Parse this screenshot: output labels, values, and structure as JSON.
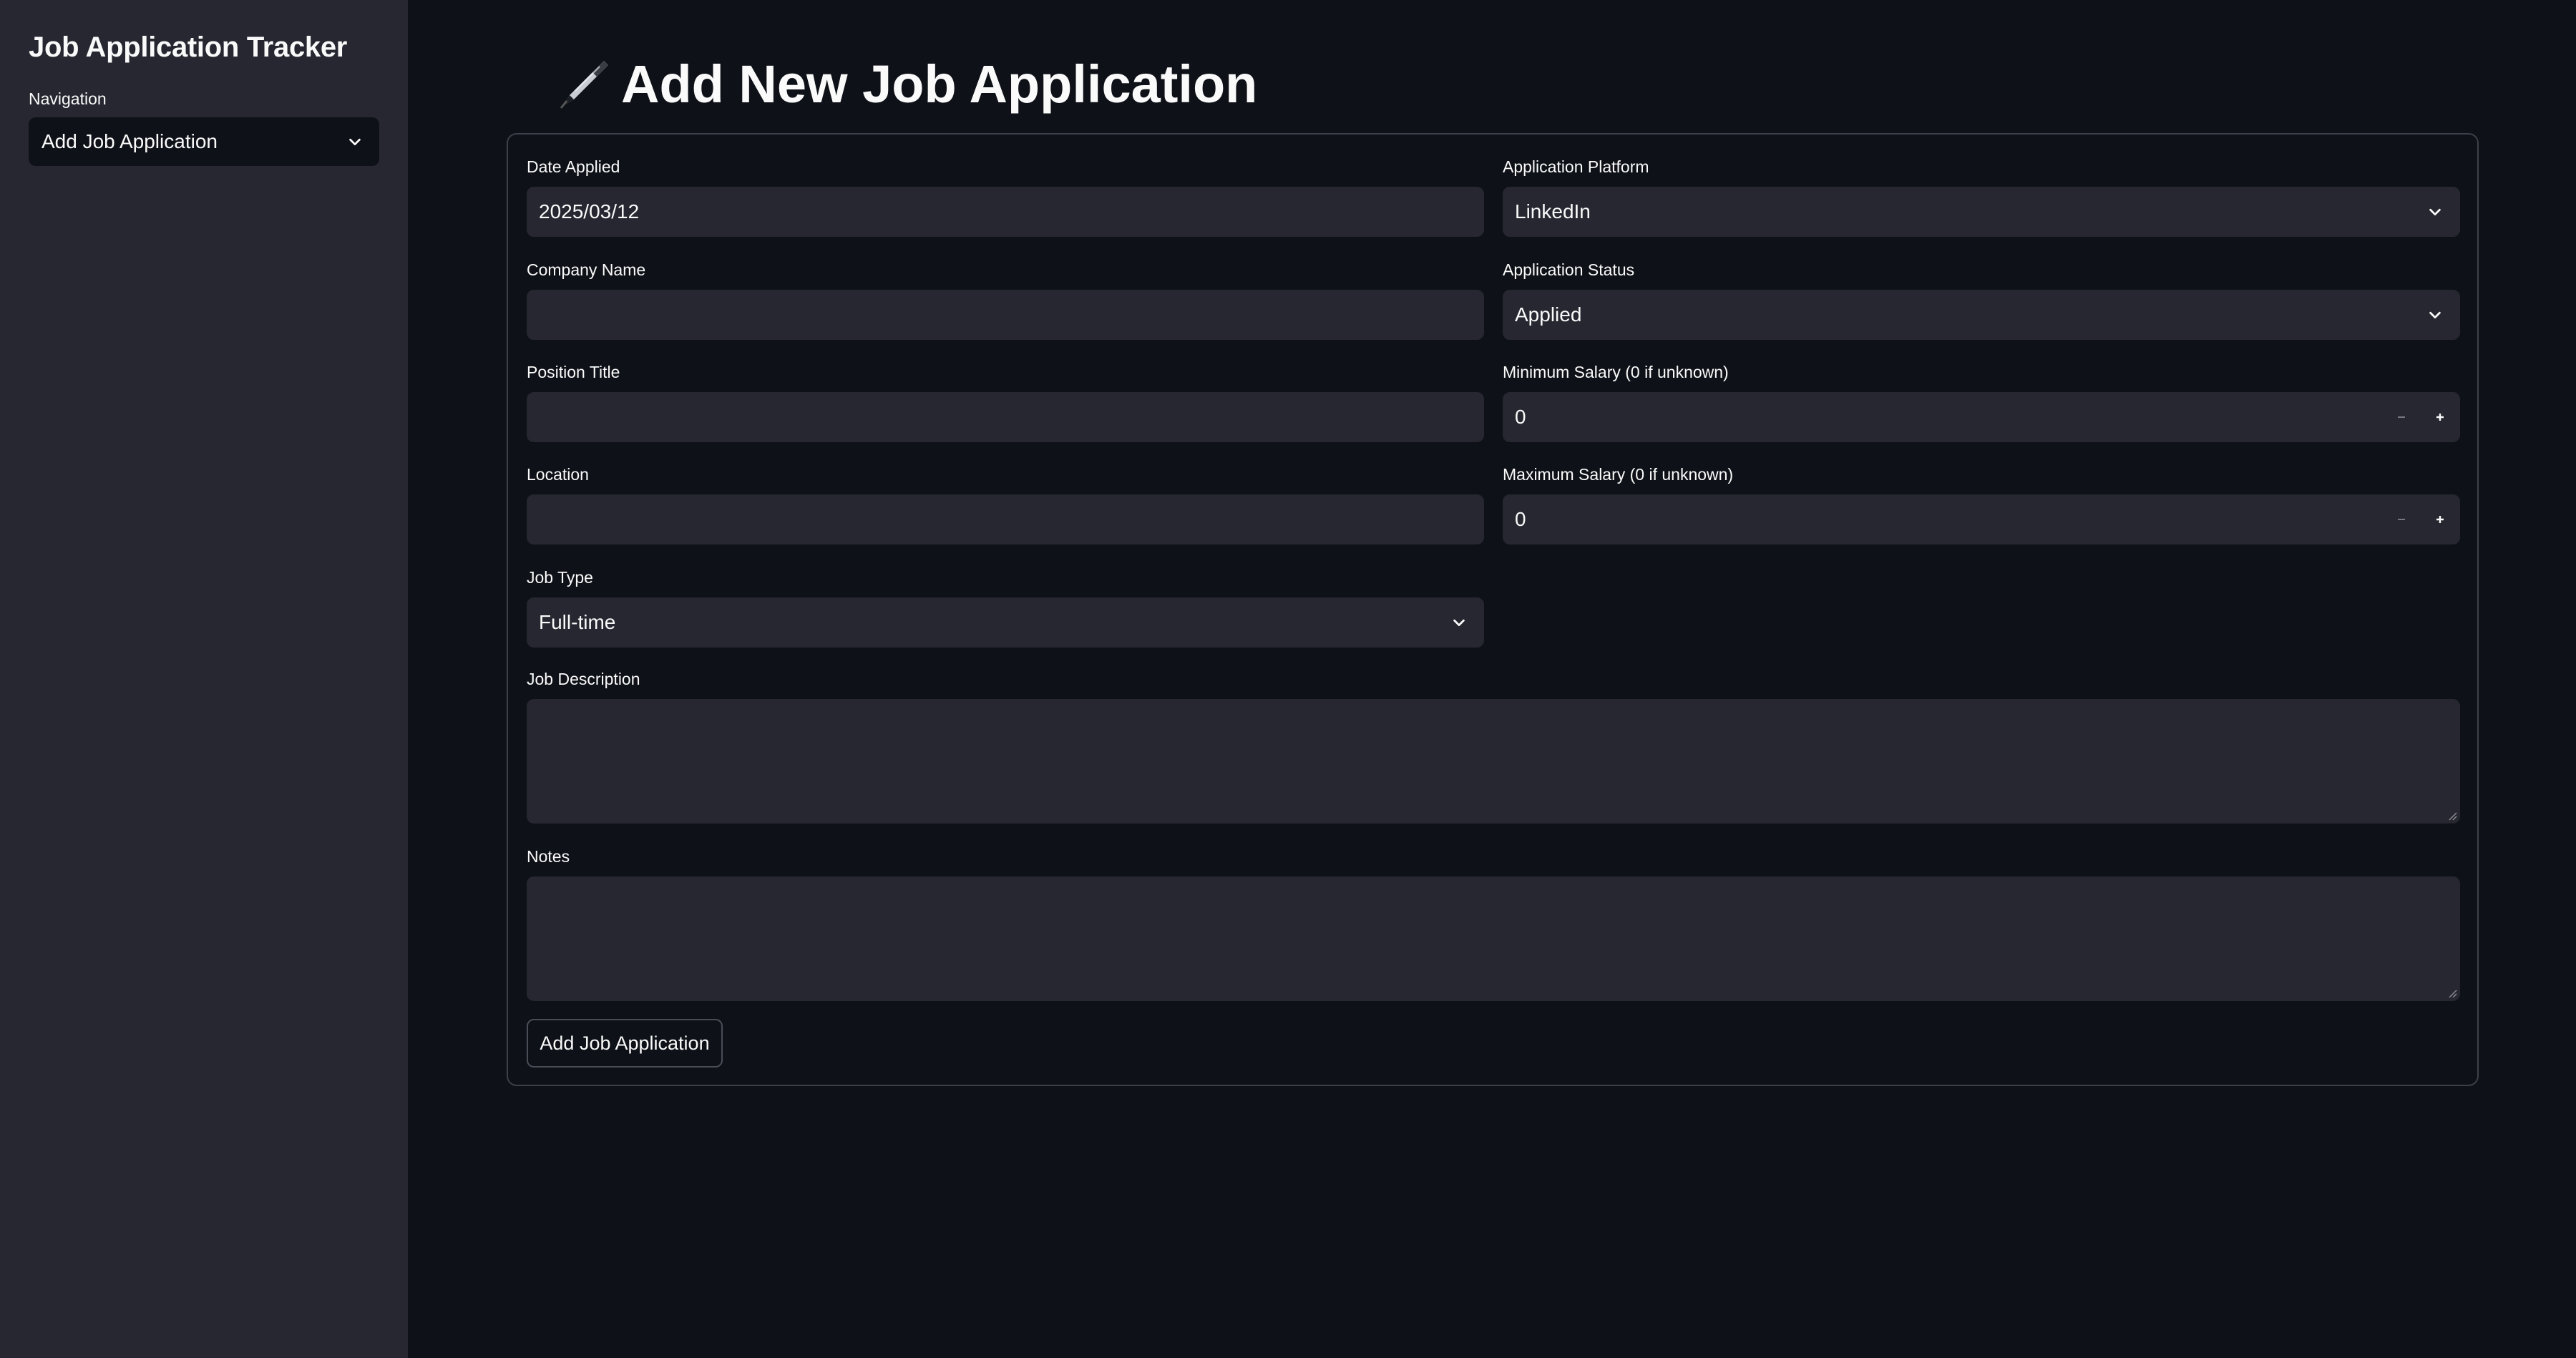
{
  "sidebar": {
    "title": "Job Application Tracker",
    "nav_label": "Navigation",
    "nav_selected": "Add Job Application"
  },
  "page": {
    "title": "Add New Job Application",
    "title_icon": "fountain-pen-icon"
  },
  "form": {
    "date_applied": {
      "label": "Date Applied",
      "value": "2025/03/12"
    },
    "platform": {
      "label": "Application Platform",
      "value": "LinkedIn"
    },
    "company": {
      "label": "Company Name",
      "value": ""
    },
    "status": {
      "label": "Application Status",
      "value": "Applied"
    },
    "position": {
      "label": "Position Title",
      "value": ""
    },
    "min_salary": {
      "label": "Minimum Salary (0 if unknown)",
      "value": "0"
    },
    "location": {
      "label": "Location",
      "value": ""
    },
    "max_salary": {
      "label": "Maximum Salary (0 if unknown)",
      "value": "0"
    },
    "job_type": {
      "label": "Job Type",
      "value": "Full-time"
    },
    "description": {
      "label": "Job Description",
      "value": ""
    },
    "notes": {
      "label": "Notes",
      "value": ""
    },
    "submit_label": "Add Job Application"
  },
  "colors": {
    "background": "#0e1117",
    "sidebar": "#262730",
    "input": "#262730",
    "text": "#fafafa"
  }
}
